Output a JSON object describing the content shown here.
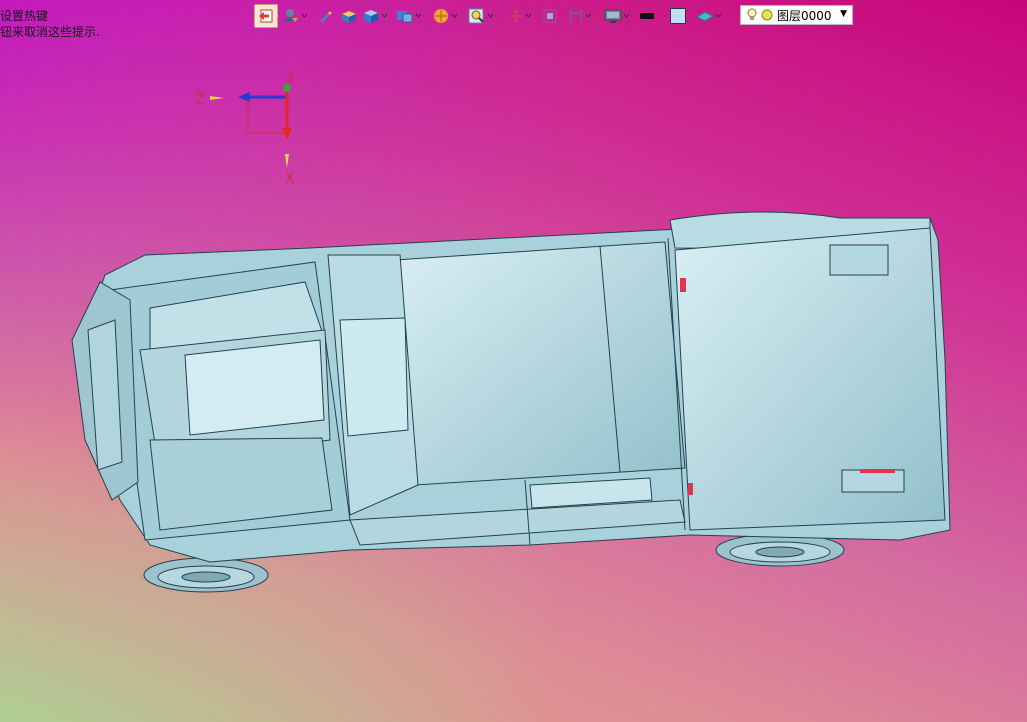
{
  "hint": {
    "line1": "设置热键",
    "line2": "钮来取消这些提示."
  },
  "toolbar": {
    "buttons": [
      {
        "name": "undo",
        "icon": "return-arrow-icon",
        "active": true
      },
      {
        "name": "filter",
        "icon": "filter-icon",
        "dropdown": true
      },
      {
        "name": "pick",
        "icon": "pencil-pick-icon"
      },
      {
        "name": "box-single",
        "icon": "box-icon"
      },
      {
        "name": "view-cube",
        "icon": "cube-view-icon",
        "dropdown": true
      },
      {
        "name": "views",
        "icon": "views-icon",
        "dropdown": true
      },
      {
        "name": "render-mode",
        "icon": "shaded-sphere-icon",
        "dropdown": true
      },
      {
        "name": "zoom",
        "icon": "zoom-icon",
        "dropdown": true
      },
      {
        "name": "rotate",
        "icon": "axis-rotate-icon",
        "dropdown": true
      },
      {
        "name": "fit",
        "icon": "fit-icon"
      },
      {
        "name": "section",
        "icon": "section-icon",
        "dropdown": true
      },
      {
        "name": "display",
        "icon": "monitor-icon",
        "dropdown": true
      }
    ],
    "line_color": "#111111",
    "face_color": "#bfe0f4",
    "layer": {
      "label": "图层0000",
      "icon": "bulb-icon"
    }
  },
  "triad": {
    "labels": {
      "z": "Z",
      "y": "Y",
      "x": "X"
    }
  },
  "colors": {
    "background_top_right": "#c8057a",
    "background_top_left": "#c214c4",
    "background_bottom_left": "#a8d496",
    "background_bottom_right": "#e49b8e",
    "model_face": "#a9d1dc",
    "model_edge": "#1f3b46"
  },
  "model": {
    "name": "truck-model"
  }
}
